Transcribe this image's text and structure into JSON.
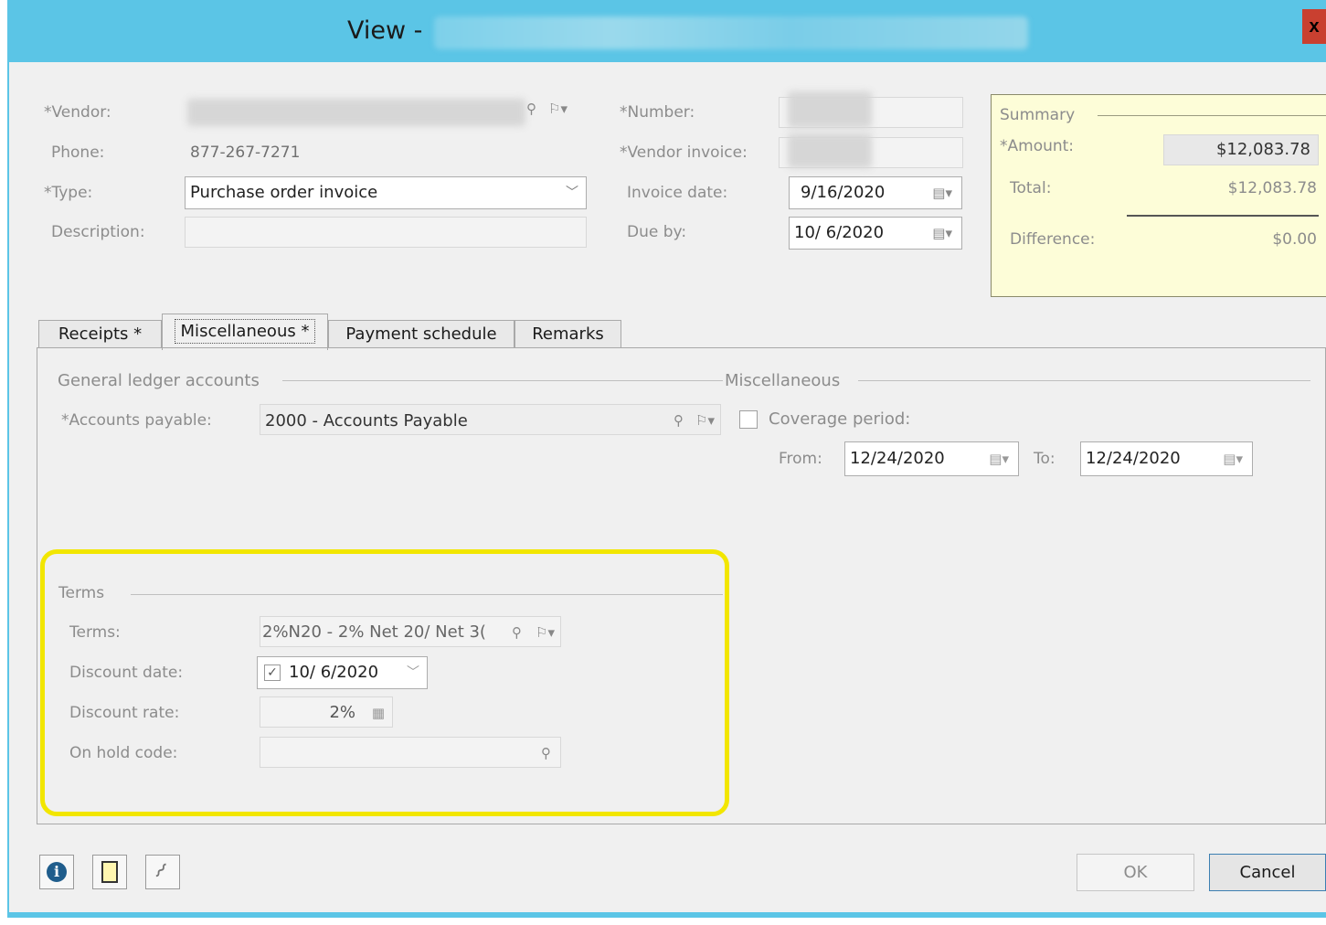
{
  "window": {
    "title_prefix": "View -",
    "close_label": "x"
  },
  "header": {
    "vendor_label": "*Vendor:",
    "phone_label": "Phone:",
    "phone_value": "877-267-7271",
    "type_label": "*Type:",
    "type_value": "Purchase order invoice",
    "description_label": "Description:",
    "description_value": "",
    "number_label": "*Number:",
    "vendor_invoice_label": "*Vendor invoice:",
    "invoice_date_label": "Invoice date:",
    "invoice_date_value": "9/16/2020",
    "due_by_label": "Due by:",
    "due_by_value": "10/ 6/2020"
  },
  "summary": {
    "title": "Summary",
    "amount_label": "*Amount:",
    "amount_value": "$12,083.78",
    "total_label": "Total:",
    "total_value": "$12,083.78",
    "difference_label": "Difference:",
    "difference_value": "$0.00"
  },
  "tabs": [
    {
      "label": "Receipts *"
    },
    {
      "label": "Miscellaneous *"
    },
    {
      "label": "Payment schedule"
    },
    {
      "label": "Remarks"
    }
  ],
  "misc": {
    "gl_section": "General ledger accounts",
    "ap_label": "*Accounts payable:",
    "ap_value": "2000 - Accounts Payable",
    "misc_section": "Miscellaneous",
    "coverage_label": "Coverage period:",
    "from_label": "From:",
    "from_value": "12/24/2020",
    "to_label": "To:",
    "to_value": "12/24/2020"
  },
  "terms": {
    "section": "Terms",
    "terms_label": "Terms:",
    "terms_value": "2%N20 - 2% Net 20/ Net 3(",
    "discount_date_label": "Discount date:",
    "discount_date_value": "10/ 6/2020",
    "discount_rate_label": "Discount rate:",
    "discount_rate_value": "2%",
    "on_hold_label": "On hold code:",
    "on_hold_value": ""
  },
  "footer": {
    "ok_label": "OK",
    "cancel_label": "Cancel"
  },
  "colors": {
    "titlebar": "#5bc5e6",
    "summary_bg": "#fdfdd8",
    "highlight": "#f2e600"
  }
}
